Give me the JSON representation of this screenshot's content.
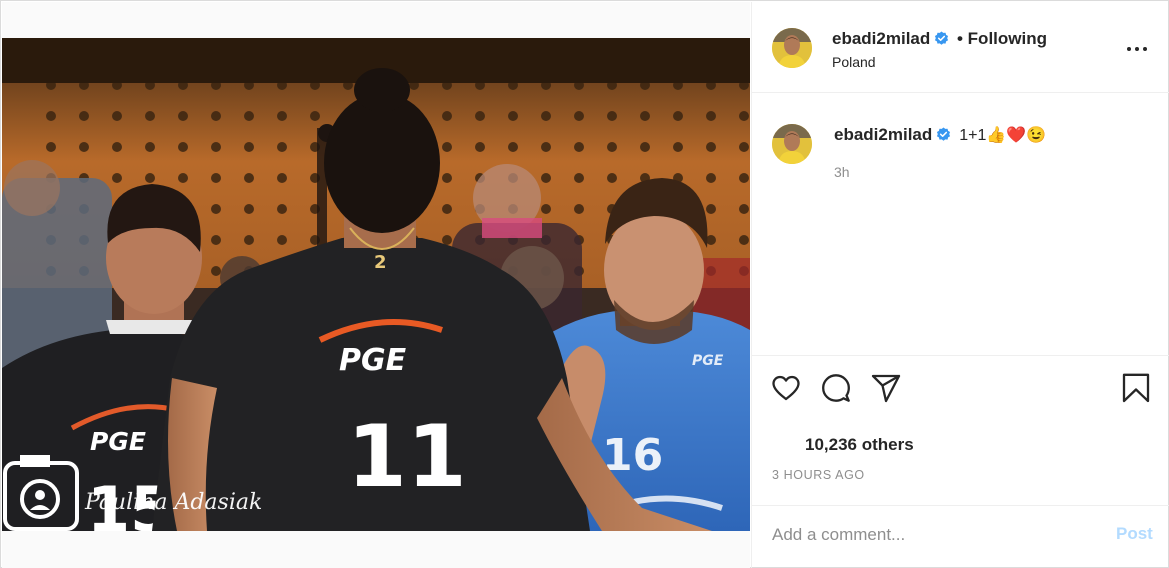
{
  "post": {
    "username": "ebadi2milad",
    "follow_status": "• Following",
    "location": "Poland",
    "caption": {
      "username": "ebadi2milad",
      "text": "1+1👍❤️😉",
      "time": "3h"
    },
    "likes_text": "10,236 others",
    "time_ago": "3 HOURS AGO",
    "comment_placeholder": "Add a comment...",
    "post_label": "Post",
    "photo": {
      "jersey_numbers": [
        "15",
        "11",
        "16"
      ],
      "sponsor_text": "PGE",
      "watermark": "Paulina Adasiak",
      "necklace_number": "2"
    }
  },
  "icons": {
    "more": "more-options-icon",
    "verified": "verified-badge-icon",
    "like": "heart-icon",
    "comment": "comment-bubble-icon",
    "share": "paper-plane-icon",
    "save": "bookmark-icon"
  },
  "colors": {
    "verified_blue": "#3897f0",
    "post_button_disabled": "#b3dbff",
    "secondary_text": "#8e8e8e",
    "border": "#dbdbdb"
  }
}
